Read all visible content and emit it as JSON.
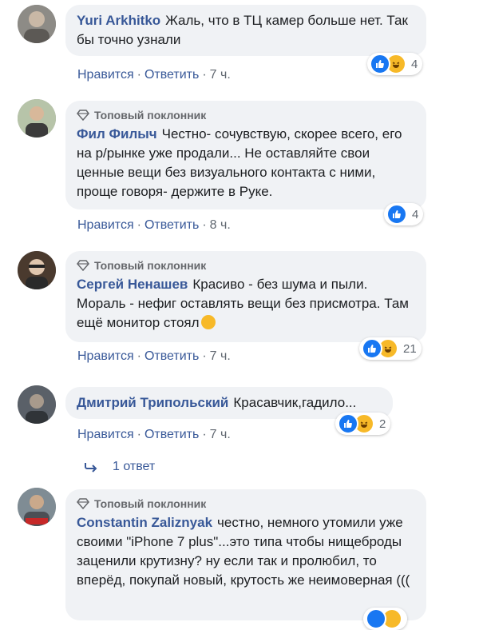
{
  "comments": [
    {
      "author": "Yuri Arkhitko",
      "text": "Жаль, что в ТЦ камер больше нет. Так бы точно узнали",
      "badge": "",
      "like_label": "Нравится",
      "reply_label": "Ответить",
      "time": "7 ч.",
      "reactions": [
        "like-icon",
        "haha-icon"
      ],
      "reaction_count": "4"
    },
    {
      "author": "Фил Филыч",
      "text": "Честно- сочувствую, скорее всего, его на р/рынке уже продали... Не оставляйте свои ценные вещи без визуального контакта с ними, проще говоря- держите в Руке.",
      "badge": "Топовый поклонник",
      "like_label": "Нравится",
      "reply_label": "Ответить",
      "time": "8 ч.",
      "reactions": [
        "like-icon"
      ],
      "reaction_count": "4"
    },
    {
      "author": "Сергей Ненашев",
      "text": "Красиво - без шума и пыли. Мораль - нефиг оставлять вещи без присмотра. Там ещё монитор стоял",
      "badge": "Топовый поклонник",
      "like_label": "Нравится",
      "reply_label": "Ответить",
      "time": "7 ч.",
      "reactions": [
        "like-icon",
        "haha-icon"
      ],
      "reaction_count": "21"
    },
    {
      "author": "Дмитрий Трипольский",
      "text": "Красавчик,гадило...",
      "badge": "",
      "like_label": "Нравится",
      "reply_label": "Ответить",
      "time": "7 ч.",
      "reactions": [
        "like-icon",
        "haha-icon"
      ],
      "reaction_count": "2"
    },
    {
      "author": "Constantin Zaliznyak",
      "text": "честно, немного утомили уже своими \"iPhone 7 plus\"...это типа чтобы нищеброды заценили крутизну? ну если так и пролюбил, то вперёд, покупай новый, крутость же неимоверная (((",
      "badge": "Топовый поклонник",
      "reactions": [
        "like-icon",
        "haha-icon"
      ]
    }
  ],
  "replies_link": "1 ответ",
  "colors": {
    "link": "#385898",
    "bubble": "#f0f2f5",
    "like": "#1877f2",
    "haha": "#f7b928"
  }
}
